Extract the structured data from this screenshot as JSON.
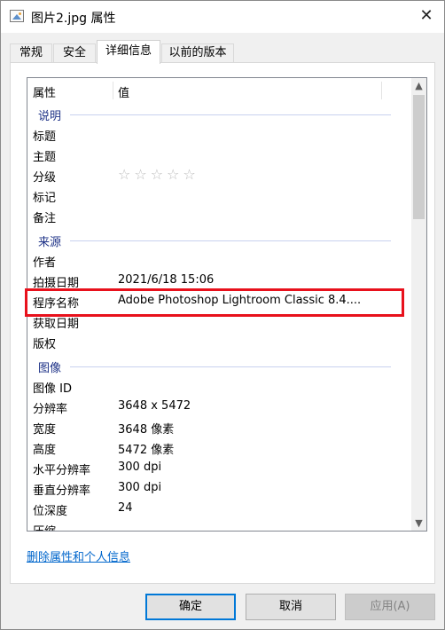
{
  "window": {
    "title": "图片2.jpg 属性",
    "close_glyph": "✕"
  },
  "tabs": [
    {
      "label": "常规"
    },
    {
      "label": "安全"
    },
    {
      "label": "详细信息",
      "active": true
    },
    {
      "label": "以前的版本"
    }
  ],
  "columns": {
    "property": "属性",
    "value": "值"
  },
  "groups": {
    "description": "说明",
    "origin": "来源",
    "image": "图像"
  },
  "description_rows": [
    {
      "key": "标题",
      "value": ""
    },
    {
      "key": "主题",
      "value": ""
    },
    {
      "key": "分级",
      "value": "☆☆☆☆☆",
      "rating": 0
    },
    {
      "key": "标记",
      "value": ""
    },
    {
      "key": "备注",
      "value": ""
    }
  ],
  "origin_rows": [
    {
      "key": "作者",
      "value": ""
    },
    {
      "key": "拍摄日期",
      "value": "2021/6/18 15:06"
    },
    {
      "key": "程序名称",
      "value": "Adobe Photoshop Lightroom Classic 8.4...."
    },
    {
      "key": "获取日期",
      "value": ""
    },
    {
      "key": "版权",
      "value": ""
    }
  ],
  "image_rows": [
    {
      "key": "图像 ID",
      "value": ""
    },
    {
      "key": "分辨率",
      "value": "3648 x 5472"
    },
    {
      "key": "宽度",
      "value": "3648 像素"
    },
    {
      "key": "高度",
      "value": "5472 像素"
    },
    {
      "key": "水平分辨率",
      "value": "300 dpi"
    },
    {
      "key": "垂直分辨率",
      "value": "300 dpi"
    },
    {
      "key": "位深度",
      "value": "24"
    },
    {
      "key": "压缩",
      "value": ""
    }
  ],
  "links": {
    "remove_properties": "删除属性和个人信息"
  },
  "buttons": {
    "ok": "确定",
    "cancel": "取消",
    "apply": "应用(A)"
  },
  "colors": {
    "highlight": "#e8111c",
    "group_label": "#1e3287",
    "link": "#0066cc"
  }
}
